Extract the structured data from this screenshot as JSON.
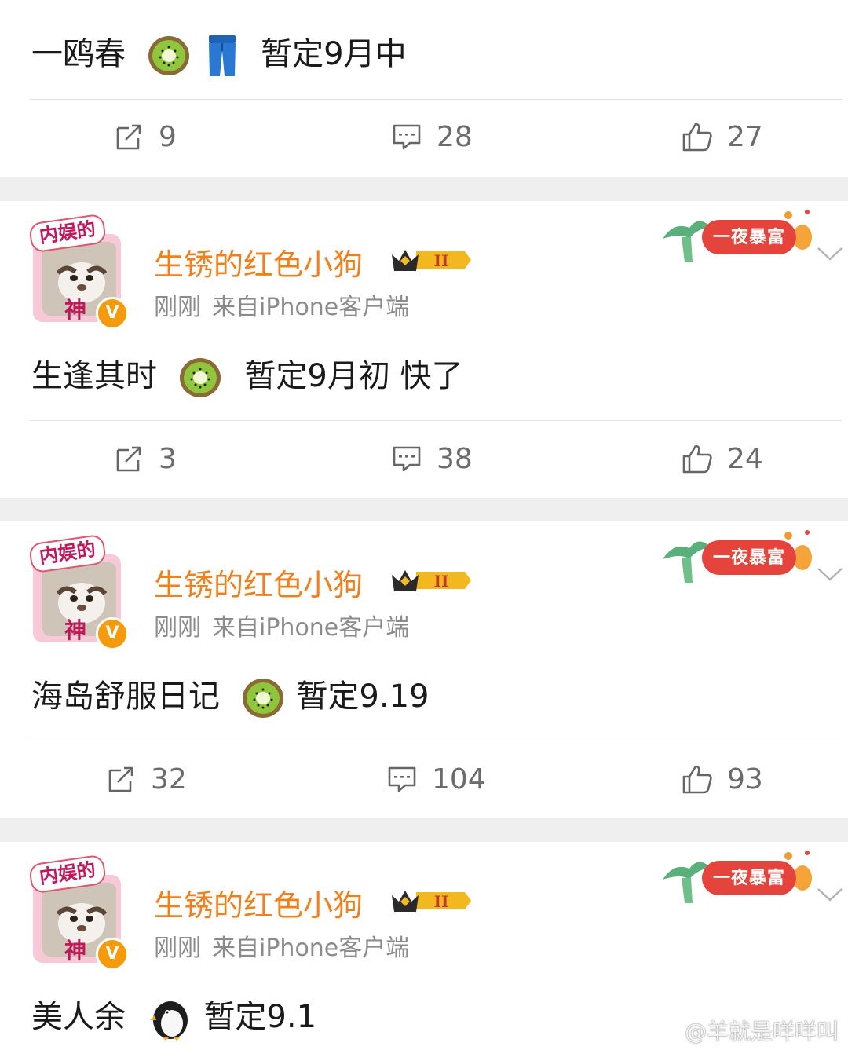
{
  "colors": {
    "username": "#f47f1a",
    "meta": "#8b8b8b",
    "action_count": "#6b6b6b",
    "verified_badge": "#f59a0a",
    "decoration": "#e4443b",
    "separator": "#efefef"
  },
  "posts": [
    {
      "id": "p0",
      "text_parts": [
        "一鸥春",
        "暂定9月中"
      ],
      "emojis": [
        "kiwi",
        "jeans"
      ],
      "actions": {
        "repost": "9",
        "comment": "28",
        "like": "27"
      }
    },
    {
      "id": "p1",
      "username": "生锈的红色小狗",
      "time": "刚刚",
      "source": "来自iPhone客户端",
      "avatar_tag_top": "内娱的",
      "avatar_tag_bottom": "神",
      "decoration_label": "一夜暴富",
      "text_parts": [
        "生逢其时",
        "暂定9月初 快了"
      ],
      "emojis": [
        "kiwi"
      ],
      "actions": {
        "repost": "3",
        "comment": "38",
        "like": "24"
      }
    },
    {
      "id": "p2",
      "username": "生锈的红色小狗",
      "time": "刚刚",
      "source": "来自iPhone客户端",
      "avatar_tag_top": "内娱的",
      "avatar_tag_bottom": "神",
      "decoration_label": "一夜暴富",
      "text_parts": [
        "海岛舒服日记",
        "暂定9.19"
      ],
      "emojis": [
        "kiwi"
      ],
      "actions": {
        "repost": "32",
        "comment": "104",
        "like": "93"
      }
    },
    {
      "id": "p3",
      "username": "生锈的红色小狗",
      "time": "刚刚",
      "source": "来自iPhone客户端",
      "avatar_tag_top": "内娱的",
      "avatar_tag_bottom": "神",
      "decoration_label": "一夜暴富",
      "text_parts": [
        "美人余",
        "暂定9.1"
      ],
      "emojis": [
        "penguin"
      ]
    }
  ],
  "icons": {
    "repost": "repost-icon",
    "comment": "comment-icon",
    "like": "thumbs-up-icon",
    "more": "chevron-down-icon",
    "verified": "verified-v-icon",
    "crown": "crown-badge-icon"
  },
  "watermark": "@羊就是咩咩叫"
}
